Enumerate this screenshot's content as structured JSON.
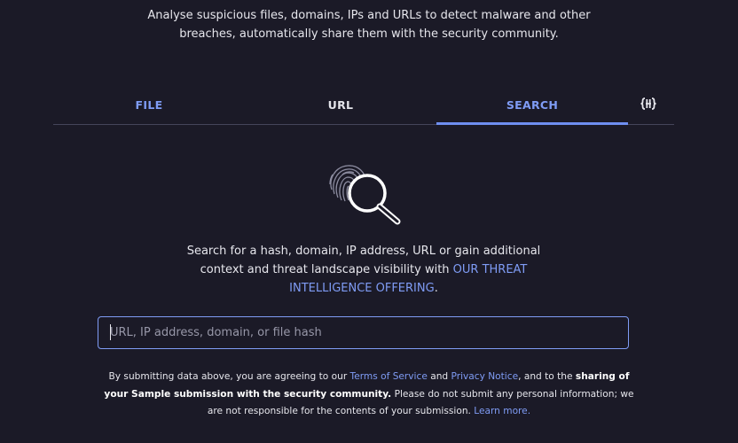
{
  "intro": {
    "line1": "Analyse suspicious files, domains, IPs and URLs to detect malware and other",
    "line2": "breaches, automatically share them with the security community."
  },
  "tabs": [
    {
      "label": "FILE"
    },
    {
      "label": "URL"
    },
    {
      "label": "SEARCH",
      "active": true
    }
  ],
  "tab_more_icon": "braces-toggle-icon",
  "hero_icon": "fingerprint-magnifier-icon",
  "search_description": {
    "text": "Search for a hash, domain, IP address, URL or gain additional context and threat landscape visibility with ",
    "link": "OUR THREAT INTELLIGENCE OFFERING",
    "suffix": "."
  },
  "search_input": {
    "placeholder": "URL, IP address, domain, or file hash",
    "value": ""
  },
  "legal": {
    "part1": "By submitting data above, you are agreeing to our ",
    "terms_link": "Terms of Service",
    "and": " and ",
    "privacy_link": "Privacy Notice",
    "part2": ", and to the ",
    "bold": "sharing of your Sample submission with the security community.",
    "part3": " Please do not submit any personal information; we are not responsible for the contents of your submission. ",
    "learn_more_link": "Learn more."
  },
  "colors": {
    "background": "#1b1a27",
    "accent": "#7f9cf5",
    "divider": "#45455a"
  }
}
